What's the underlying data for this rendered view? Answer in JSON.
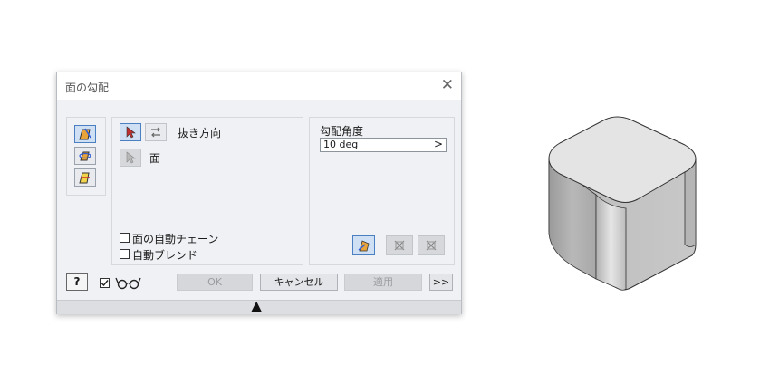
{
  "dialog": {
    "title": "面の勾配",
    "close_glyph": "✕",
    "direction_label": "抜き方向",
    "faces_label": "面",
    "auto_chain_label": "面の自動チェーン",
    "auto_blend_label": "自動ブレンド",
    "angle_label": "勾配角度",
    "angle_value": "10 deg",
    "angle_arrow": ">",
    "ok_label": "OK",
    "cancel_label": "キャンセル",
    "apply_label": "適用",
    "more_label": ">>",
    "help_glyph": "?",
    "footer_glyph": "▲",
    "auto_chain_checked": false,
    "auto_blend_checked": false,
    "preview_checked": true
  },
  "colors": {
    "accent": "#4a7fc1",
    "draft_icon": "#e8a33a"
  }
}
